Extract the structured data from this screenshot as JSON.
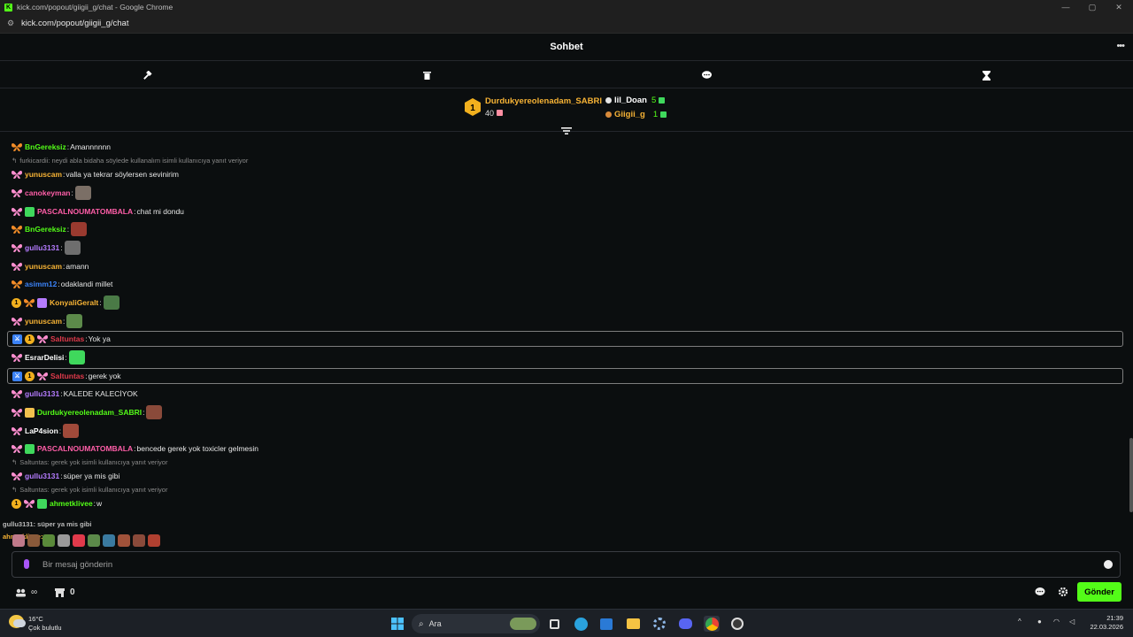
{
  "browser": {
    "title": "kick.com/popout/giigii_g/chat - Google Chrome",
    "url": "kick.com/popout/giigii_g/chat",
    "minimize": "—",
    "maximize": "▢",
    "close": "✕"
  },
  "chat": {
    "title": "Sohbet",
    "more": "•••"
  },
  "leaderboard": {
    "first": {
      "rank": "1",
      "name": "Durdukyereolenadam_SABRI",
      "value": "40"
    },
    "second": {
      "name": "lil_Doan",
      "value": "5"
    },
    "third": {
      "name": "Giigii_g",
      "value": "1"
    }
  },
  "colors": {
    "accent": "#53fc18",
    "og_badge": "#f2b01e",
    "mod_badge": "#3b82f6"
  },
  "messages": [
    {
      "user": "BnGereksiz",
      "color": "#53fc18",
      "badges": [
        "butterfly-orange"
      ],
      "text": "Amannnnnn"
    },
    {
      "reply": "furkicardii: neydi abla bidaha söylede kullanalım isimli kullanıcıya yanıt veriyor"
    },
    {
      "user": "yunuscam",
      "color": "#f7b335",
      "badges": [
        "butterfly-pink"
      ],
      "text": "valla ya tekrar söylersen sevinirim"
    },
    {
      "user": "canokeyman",
      "color": "#ff5ea8",
      "badges": [
        "butterfly-pink"
      ],
      "text": "",
      "emote": "#7b6f66"
    },
    {
      "user": "PASCALNOUMATOMBALA",
      "color": "#ff5ea8",
      "badges": [
        "butterfly-pink",
        "gift-green"
      ],
      "text": "chat mi dondu"
    },
    {
      "user": "BnGereksiz",
      "color": "#53fc18",
      "badges": [
        "butterfly-orange"
      ],
      "text": "",
      "emote": "#9a3a2f"
    },
    {
      "user": "gullu3131",
      "color": "#b57cff",
      "badges": [
        "butterfly-pink"
      ],
      "text": "",
      "emote": "#6e6e6e"
    },
    {
      "user": "yunuscam",
      "color": "#f7b335",
      "badges": [
        "butterfly-pink"
      ],
      "text": "amann"
    },
    {
      "user": "asimm12",
      "color": "#3b82f6",
      "badges": [
        "butterfly-orange"
      ],
      "text": "odaklandi millet"
    },
    {
      "user": "KonyaliGeralt",
      "color": "#f7b335",
      "badges": [
        "og",
        "butterfly-orange",
        "gift-purple"
      ],
      "text": "",
      "emote": "#4a7a46"
    },
    {
      "user": "yunuscam",
      "color": "#f7b335",
      "badges": [
        "butterfly-pink"
      ],
      "text": "",
      "emote": "#5c8a4a"
    },
    {
      "user": "Saltuntas",
      "color": "#e13a4b",
      "badges": [
        "mod",
        "og",
        "butterfly-pink"
      ],
      "text": "Yok ya",
      "highlight": true
    },
    {
      "user": "EsrarDelisi",
      "color": "#ffffff",
      "badges": [
        "butterfly-pink"
      ],
      "text": "",
      "emote": "#3fd85c"
    },
    {
      "user": "Saltuntas",
      "color": "#e13a4b",
      "badges": [
        "mod",
        "og",
        "butterfly-pink"
      ],
      "text": "gerek yok",
      "highlight": true
    },
    {
      "user": "gullu3131",
      "color": "#b57cff",
      "badges": [
        "butterfly-pink"
      ],
      "text": "KALEDE KALECİYOK"
    },
    {
      "user": "Durdukyereolenadam_SABRI",
      "color": "#53fc18",
      "badges": [
        "butterfly-pink",
        "gift-yellow"
      ],
      "text": "",
      "emote": "#8a4a3a"
    },
    {
      "user": "LaP4sion",
      "color": "#ffffff",
      "badges": [
        "butterfly-pink"
      ],
      "text": "",
      "emote": "#a04a3a"
    },
    {
      "user": "PASCALNOUMATOMBALA",
      "color": "#ff5ea8",
      "badges": [
        "butterfly-pink",
        "gift-green"
      ],
      "text": "bencede gerek yok toxicler gelmesin"
    },
    {
      "reply": "Saltuntas: gerek yok isimli kullanıcıya yanıt veriyor"
    },
    {
      "user": "gullu3131",
      "color": "#b57cff",
      "badges": [
        "butterfly-pink"
      ],
      "text": "süper ya mis gibi"
    },
    {
      "reply": "Saltuntas: gerek yok isimli kullanıcıya yanıt veriyor"
    },
    {
      "user": "ahmetklivee",
      "color": "#53fc18",
      "badges": [
        "og",
        "butterfly-pink",
        "gift-green"
      ],
      "text": "w"
    }
  ],
  "overlap": {
    "line1": "gullu3131: süper ya mis gibi",
    "line2": "ahmetklivee: w"
  },
  "composer": {
    "placeholder": "Bir mesaj gönderin"
  },
  "bottombar": {
    "viewers": "∞",
    "store_count": "0",
    "send_label": "Gönder"
  },
  "taskbar": {
    "temp": "16°C",
    "weather": "Çok bulutlu",
    "search": "Ara",
    "time": "21:39",
    "date": "22.03.2026"
  }
}
